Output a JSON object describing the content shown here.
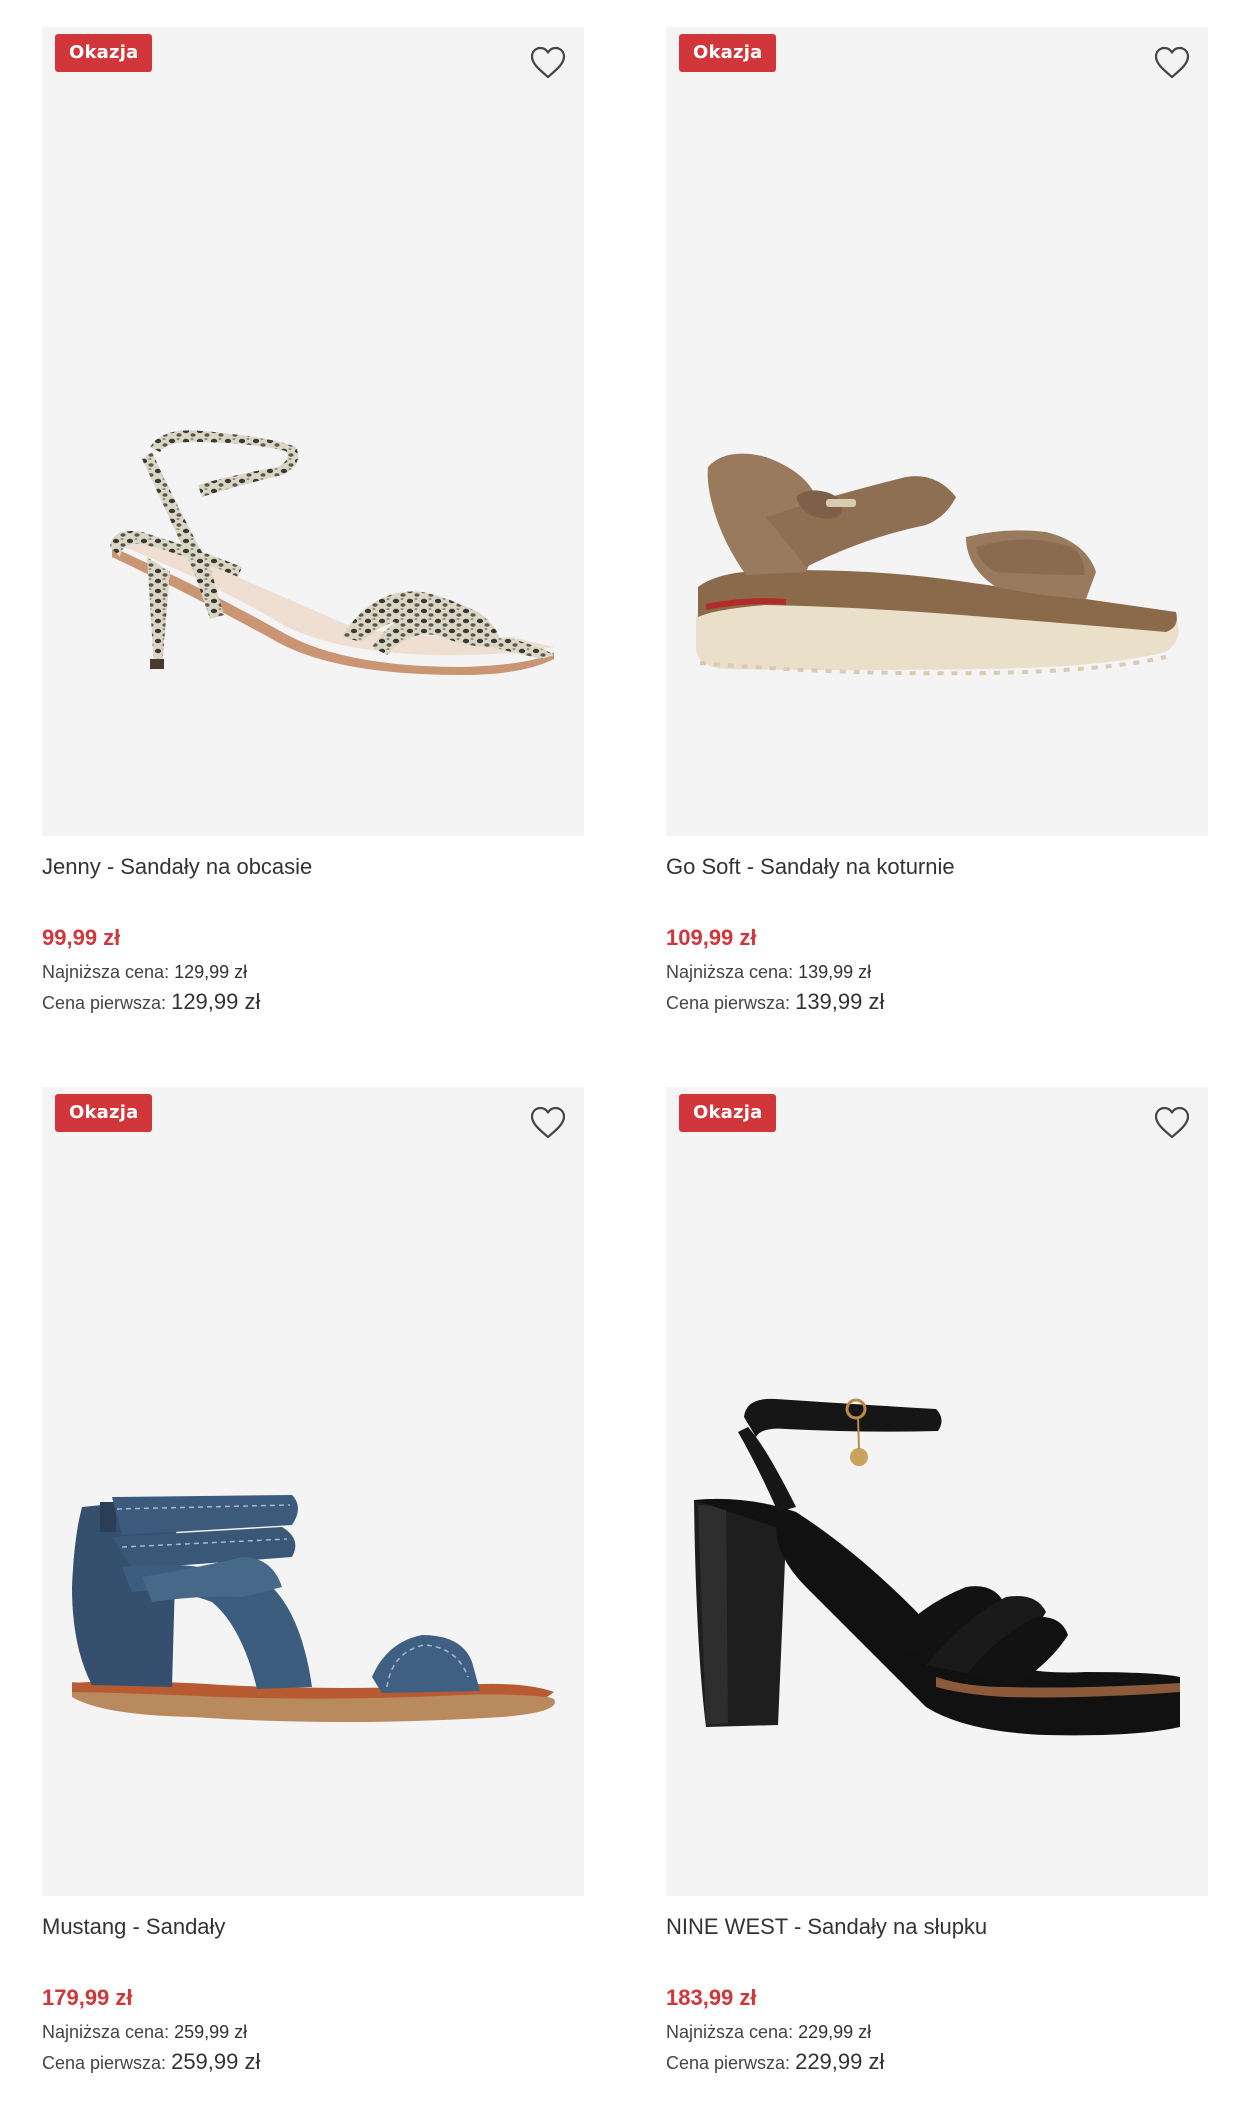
{
  "colors": {
    "accent": "#d1363a",
    "image_bg": "#f4f4f4"
  },
  "products": [
    {
      "badge": "Okazja",
      "wishlist_icon": "heart-outline-icon",
      "name": "Jenny - Sandały na obcasie",
      "price": "99,99 zł",
      "lowest_label": "Najniższa cena:",
      "lowest_value": "129,99 zł",
      "first_label": "Cena pierwsza:",
      "first_value": "129,99 zł"
    },
    {
      "badge": "Okazja",
      "wishlist_icon": "heart-outline-icon",
      "name": "Go Soft - Sandały na koturnie",
      "price": "109,99 zł",
      "lowest_label": "Najniższa cena:",
      "lowest_value": "139,99 zł",
      "first_label": "Cena pierwsza:",
      "first_value": "139,99 zł"
    },
    {
      "badge": "Okazja",
      "wishlist_icon": "heart-outline-icon",
      "name": "Mustang - Sandały",
      "price": "179,99 zł",
      "lowest_label": "Najniższa cena:",
      "lowest_value": "259,99 zł",
      "first_label": "Cena pierwsza:",
      "first_value": "259,99 zł"
    },
    {
      "badge": "Okazja",
      "wishlist_icon": "heart-outline-icon",
      "name": "NINE WEST - Sandały na słupku",
      "price": "183,99 zł",
      "lowest_label": "Najniższa cena:",
      "lowest_value": "229,99 zł",
      "first_label": "Cena pierwsza:",
      "first_value": "229,99 zł"
    }
  ]
}
